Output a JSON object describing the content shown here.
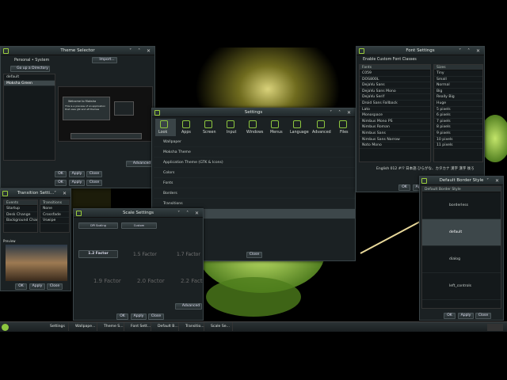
{
  "theme_selector": {
    "title": "Theme Selector",
    "scope": "Personal  • System",
    "import": "Import...",
    "goto": "Go up a Directory",
    "items": [
      "default",
      "Moksha Green"
    ],
    "preview_welcome": "Welcome to Moksha",
    "preview_line1": "This is a preview of an application",
    "preview_line2": "that uses gtk and efl themes",
    "advanced": "Advanced",
    "ok": "OK",
    "apply": "Apply",
    "close": "Close"
  },
  "transition": {
    "title": "Transition Setti...",
    "col1": "Events",
    "col2": "Transitions",
    "events": [
      "Startup",
      "Desk Change",
      "Background Change"
    ],
    "transitions": [
      "None",
      "Crossfade",
      "Vswipe"
    ],
    "preview": "Preview",
    "ok": "OK",
    "apply": "Apply",
    "close": "Close"
  },
  "scale": {
    "title": "Scale Settings",
    "cells": [
      "DPI Scaling",
      "Custom",
      "1.2 Factor",
      "1.5 Factor",
      "1.7 Factor",
      "1.9 Factor",
      "2.0 Factor",
      "2.2 Factor"
    ],
    "advanced": "Advanced",
    "ok": "OK",
    "apply": "Apply",
    "close": "Close"
  },
  "settings": {
    "title": "Settings",
    "tabs": [
      "Look",
      "Apps",
      "Screen",
      "Input",
      "Windows",
      "Menus",
      "Language",
      "Advanced",
      "Files"
    ],
    "items": [
      "Wallpaper",
      "Moksha Theme",
      "Application Theme (GTK & Icons)",
      "Colors",
      "Fonts",
      "Borders",
      "Transitions",
      "Scale"
    ],
    "close": "Close"
  },
  "font": {
    "title": "Font Settings",
    "enable": "Enable Custom Font Classes",
    "fonts_hdr": "Fonts",
    "sizes_hdr": "Sizes",
    "fonts": [
      "C059",
      "DOS800L",
      "DejaVu Sans",
      "DejaVu Sans Mono",
      "DejaVu Serif",
      "Droid Sans Fallback",
      "Lato",
      "Monospace",
      "Nimbus Mono PS",
      "Nimbus Roman",
      "Nimbus Sans",
      "Nimbus Sans Narrow",
      "Noto Mono"
    ],
    "sizes": [
      "Tiny",
      "Small",
      "Normal",
      "Big",
      "Really Big",
      "Huge",
      "5 pixels",
      "6 pixels",
      "7 pixels",
      "8 pixels",
      "9 pixels",
      "10 pixels",
      "11 pixels"
    ],
    "sample": "English 012 #!? 日本語 ひらがな、カタカナ 漢字 漢字 後ろ",
    "ok": "OK",
    "apply": "Apply"
  },
  "border": {
    "title": "Default Border Style",
    "header": "Default Border Style",
    "styles": [
      "borderless",
      "default",
      "dialog",
      "left_controls"
    ],
    "ok": "OK",
    "apply": "Apply",
    "close": "Close"
  },
  "taskbar": {
    "items": [
      "Settings",
      "Wallpape...",
      "Theme S...",
      "Font Sett...",
      "Default B...",
      "Transitio...",
      "Scale Se..."
    ]
  },
  "colors": {
    "accent": "#8dc63f",
    "bg": "#1b2123"
  }
}
